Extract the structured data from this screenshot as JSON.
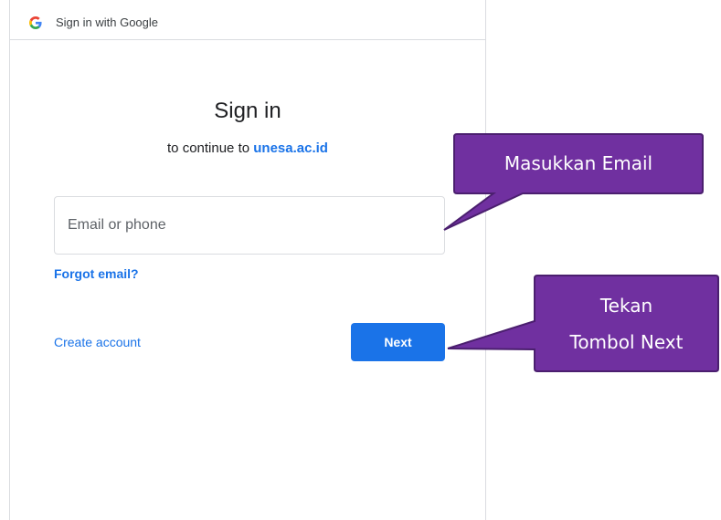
{
  "header": {
    "title": "Sign in with Google",
    "logo": "google-g-icon"
  },
  "main": {
    "title": "Sign in",
    "subtitle_prefix": "to continue to",
    "subtitle_domain": "unesa.ac.id",
    "email_placeholder": "Email or phone",
    "forgot_label": "Forgot email?",
    "create_label": "Create account",
    "next_label": "Next"
  },
  "callouts": {
    "email": "Masukkan Email",
    "next_line1": "Tekan",
    "next_line2": "Tombol Next"
  },
  "colors": {
    "accent": "#1a73e8",
    "callout": "#7030a0",
    "callout_border": "#4b1f6f"
  }
}
